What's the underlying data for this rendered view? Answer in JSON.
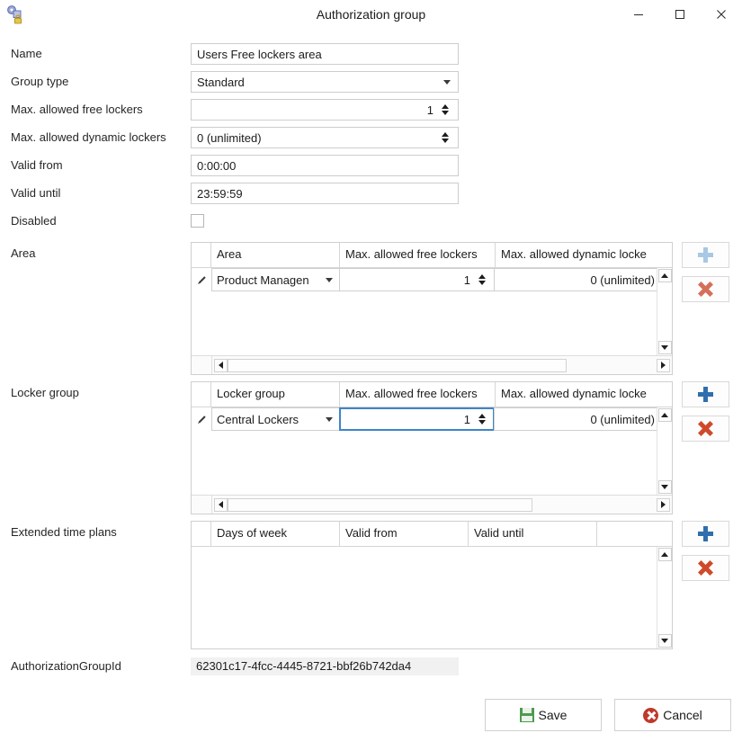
{
  "window": {
    "title": "Authorization group",
    "icon": "authorization-group-icon",
    "controls": {
      "minimize": "─",
      "maximize": "□",
      "close": "✕"
    }
  },
  "form": {
    "fields": [
      {
        "label": "Name",
        "value": "Users Free lockers area",
        "type": "text"
      },
      {
        "label": "Group type",
        "value": "Standard",
        "type": "combo"
      },
      {
        "label": "Max. allowed free lockers",
        "value": "1",
        "type": "spinner"
      },
      {
        "label": "Max. allowed dynamic lockers",
        "value": "0 (unlimited)",
        "type": "spinner"
      },
      {
        "label": "Valid from",
        "value": "0:00:00",
        "type": "text"
      },
      {
        "label": "Valid until",
        "value": "23:59:59",
        "type": "text"
      },
      {
        "label": "Disabled",
        "value": "",
        "type": "checkbox",
        "checked": false
      }
    ]
  },
  "grids": [
    {
      "label": "Area",
      "name": "area-grid",
      "columns": [
        "Area",
        "Max. allowed free lockers",
        "Max. allowed dynamic locke"
      ],
      "rows": [
        {
          "cells": [
            "Product Managen",
            "1",
            "0 (unlimited)"
          ],
          "focused_cell": -1
        }
      ],
      "add_label": "+",
      "delete_label": "✕",
      "add_enabled": false
    },
    {
      "label": "Locker group",
      "name": "locker-group-grid",
      "columns": [
        "Locker group",
        "Max. allowed free lockers",
        "Max. allowed dynamic locke"
      ],
      "rows": [
        {
          "cells": [
            "Central Lockers",
            "1",
            "0 (unlimited)"
          ],
          "focused_cell": 1
        }
      ],
      "add_label": "+",
      "delete_label": "✕",
      "add_enabled": true
    },
    {
      "label": "Extended time plans",
      "name": "extended-time-plans-grid",
      "columns": [
        "Days of week",
        "Valid from",
        "Valid until",
        ""
      ],
      "rows": [],
      "add_label": "+",
      "delete_label": "✕",
      "add_enabled": true
    }
  ],
  "footer": {
    "guid_label": "AuthorizationGroupId",
    "guid_value": "62301c17-4fcc-4445-8721-bbf26b742da4",
    "save_label": "Save",
    "cancel_label": "Cancel"
  },
  "colors": {
    "accent_blue": "#2f6fad",
    "accent_blue_disabled": "#a8c8e4",
    "delete_red": "#cf4a2b",
    "save_green": "#4f9a4f",
    "cancel_red": "#c0392b",
    "focus_border": "#3f84c8"
  }
}
